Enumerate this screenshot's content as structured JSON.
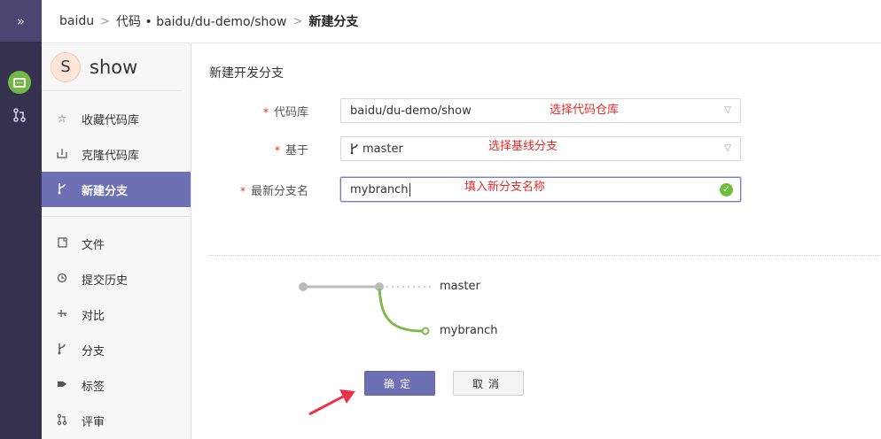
{
  "rail": {
    "toggle": "»"
  },
  "breadcrumb": {
    "org": "baidu",
    "sep1": ">",
    "repo": "代码 • baidu/du-demo/show",
    "sep2": ">",
    "current": "新建分支"
  },
  "sidebar": {
    "repo_initial": "S",
    "repo_name": "show",
    "top_items": [
      {
        "label": "收藏代码库",
        "icon": "star-icon"
      },
      {
        "label": "克隆代码库",
        "icon": "clone-icon"
      },
      {
        "label": "新建分支",
        "icon": "branch-icon",
        "active": true
      }
    ],
    "items": [
      {
        "label": "文件",
        "icon": "file-icon"
      },
      {
        "label": "提交历史",
        "icon": "history-icon"
      },
      {
        "label": "对比",
        "icon": "compare-icon"
      },
      {
        "label": "分支",
        "icon": "branch-icon"
      },
      {
        "label": "标签",
        "icon": "tag-icon"
      },
      {
        "label": "评审",
        "icon": "pull-request-icon"
      }
    ]
  },
  "main": {
    "title": "新建开发分支",
    "form": {
      "repo_label": "代码库",
      "repo_value": "baidu/du-demo/show",
      "base_label": "基于",
      "base_value": "master",
      "name_label": "最新分支名",
      "name_value": "mybranch"
    },
    "notes": {
      "repo": "选择代码仓库",
      "base": "选择基线分支",
      "name": "填入新分支名称"
    },
    "graph": {
      "base_branch": "master",
      "new_branch": "mybranch"
    },
    "buttons": {
      "confirm": "确定",
      "cancel": "取消"
    }
  },
  "colors": {
    "accent": "#6d70b5",
    "rail": "#35314f",
    "success": "#6fbf3f",
    "annotation": "#e02b2b"
  }
}
